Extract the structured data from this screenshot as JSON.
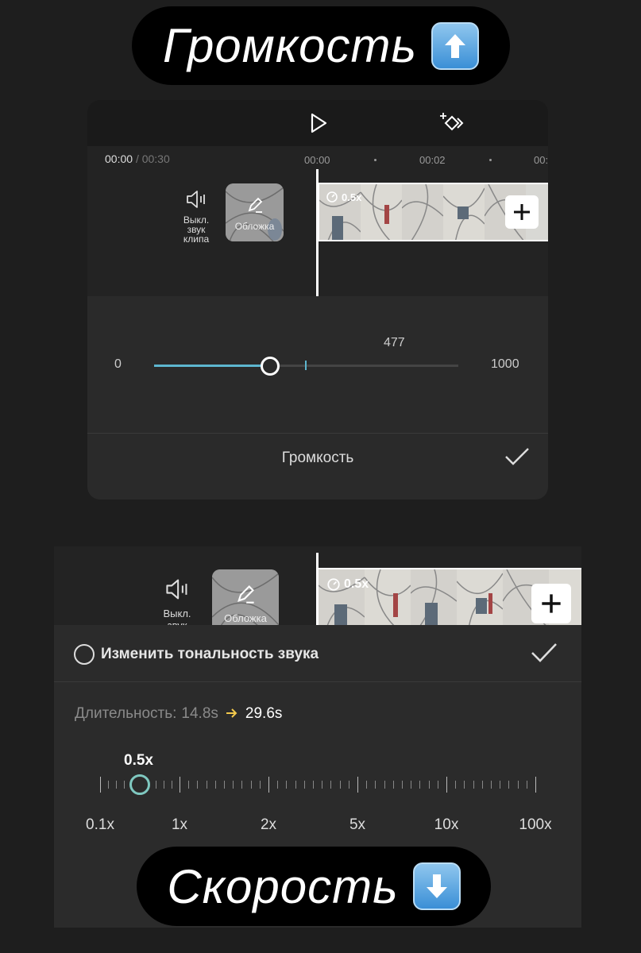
{
  "top_banner": {
    "text": "Громкость",
    "emoji": "up-arrow-emoji"
  },
  "bottom_banner": {
    "text": "Скорость",
    "emoji": "down-arrow-emoji"
  },
  "editor_volume": {
    "toolbar": {
      "play_icon": "play-icon",
      "keyframe_icon": "keyframe-add-icon"
    },
    "time_current": "00:00",
    "time_separator": "/",
    "time_total": "00:30",
    "ruler": [
      "00:00",
      "00:02",
      "00:"
    ],
    "mute_label": "Выкл. звук клипа",
    "cover_label": "Обложка",
    "clip_speed": "0.5x",
    "volume": {
      "min_label": "0",
      "max_label": "1000",
      "value_label": "477",
      "value": 477,
      "min": 0,
      "max": 1000
    },
    "footer_title": "Громкость"
  },
  "editor_speed": {
    "mute_label": "Выкл. звук",
    "cover_label": "Обложка",
    "clip_speed": "0.5x",
    "pitch_label": "Изменить тональность звука",
    "duration_label": "Длительность:",
    "duration_from": "14.8s",
    "duration_to": "29.6s",
    "current_speed": "0.5x",
    "scale_labels": [
      "0.1x",
      "1x",
      "2x",
      "5x",
      "10x",
      "100x"
    ],
    "accent_color": "#5db6cf",
    "arrow_color": "#f2c94c"
  }
}
